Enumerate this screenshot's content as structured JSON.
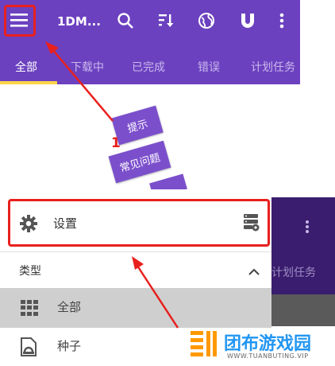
{
  "app": {
    "title": "1DM...",
    "tabs": [
      "全部",
      "下载中",
      "已完成",
      "错误",
      "计划任务"
    ],
    "active_tab": 0
  },
  "annotation": {
    "step_number": "1",
    "red_color": "#e8201d"
  },
  "tips": [
    "提示",
    "常见问题"
  ],
  "drawer": {
    "settings_label": "设置",
    "section_label": "类型",
    "items": [
      "全部",
      "种子"
    ]
  },
  "background": {
    "partial_tab": "计划任务"
  },
  "watermark": {
    "brand": "团布游戏园",
    "url": "WWW.TUANBUTING.VIP"
  },
  "colors": {
    "primary": "#6c41c0",
    "tab_indicator": "#ffd54a"
  }
}
